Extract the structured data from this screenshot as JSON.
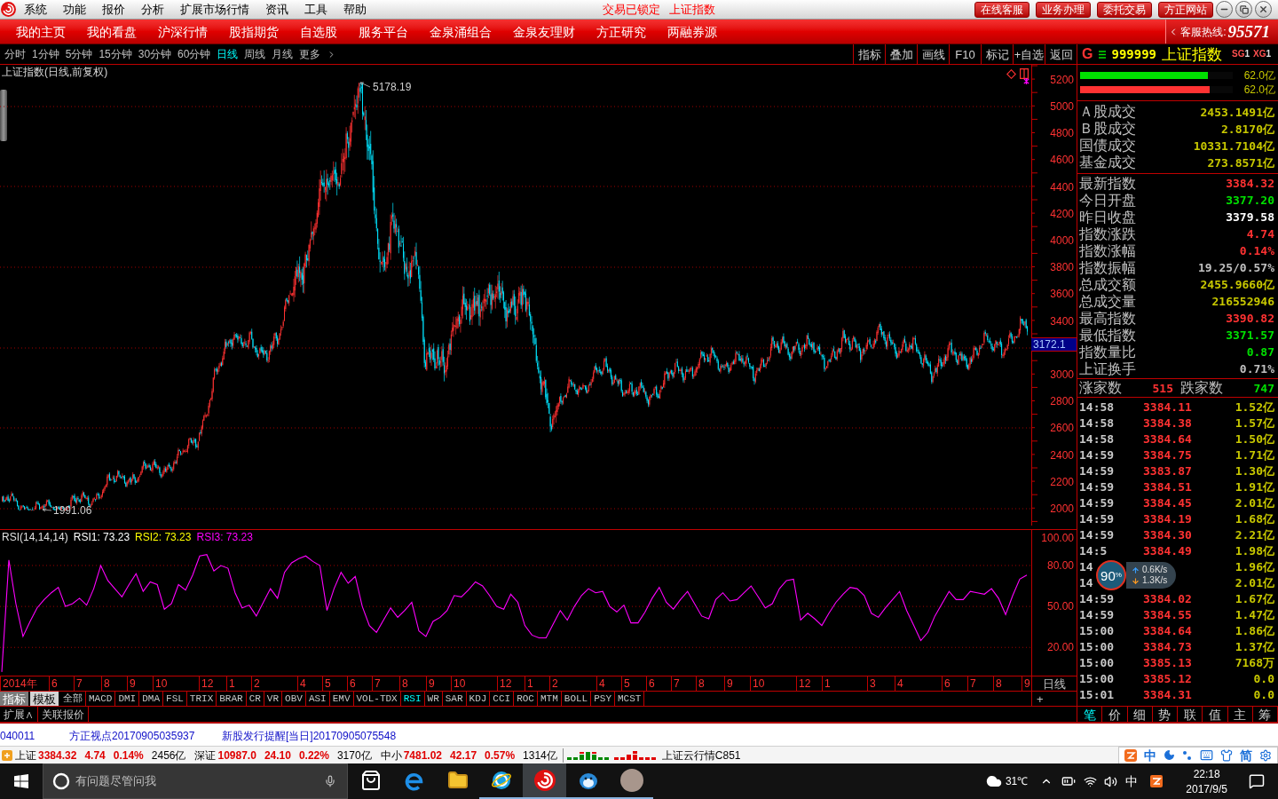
{
  "menu_bar": {
    "menus": [
      "系统",
      "功能",
      "报价",
      "分析",
      "扩展市场行情",
      "资讯",
      "工具",
      "帮助"
    ],
    "status": [
      "交易已锁定",
      "上证指数"
    ],
    "buttons": [
      "在线客服",
      "业务办理",
      "委托交易",
      "方正网站"
    ]
  },
  "nav_bar": {
    "items": [
      "我的主页",
      "我的看盘",
      "沪深行情",
      "股指期货",
      "自选股",
      "服务平台",
      "金泉涌组合",
      "金泉友理财",
      "方正研究",
      "两融券源"
    ],
    "hotline_label": "客服热线:",
    "hotline_number": "95571"
  },
  "period_bar": {
    "periods": [
      {
        "label": "分时",
        "selected": false
      },
      {
        "label": "1分钟",
        "selected": false
      },
      {
        "label": "5分钟",
        "selected": false
      },
      {
        "label": "15分钟",
        "selected": false
      },
      {
        "label": "30分钟",
        "selected": false
      },
      {
        "label": "60分钟",
        "selected": false
      },
      {
        "label": "日线",
        "selected": true
      },
      {
        "label": "周线",
        "selected": false
      },
      {
        "label": "月线",
        "selected": false
      }
    ],
    "more": "更多"
  },
  "chart_tools": [
    "指标",
    "叠加",
    "画线",
    "F10",
    "标记",
    "+自选",
    "返回"
  ],
  "quote_header": {
    "letter": "G",
    "code": "999999",
    "name": "上证指数",
    "flags": [
      {
        "label": "SG",
        "count": "1"
      },
      {
        "label": "XG",
        "count": "1"
      }
    ]
  },
  "main_chart": {
    "title": "上证指数(日线,前复权)",
    "high_label": "5178.19",
    "low_label": "1991.06",
    "price_axis": [
      "5200",
      "5000",
      "4800",
      "4600",
      "4400",
      "4200",
      "4000",
      "3800",
      "3600",
      "3400",
      "3000",
      "2800",
      "2600",
      "2400",
      "2200",
      "2000"
    ],
    "cursor_price": "3172.1"
  },
  "rsi_panel": {
    "legend": [
      {
        "text": "RSI(14,14,14)",
        "color": "#e0e0e0"
      },
      {
        "text": "RSI1: 73.23",
        "color": "#ffffff"
      },
      {
        "text": "RSI2: 73.23",
        "color": "#ffff00"
      },
      {
        "text": "RSI3: 73.23",
        "color": "#ff00ff"
      }
    ],
    "chart_data": {
      "type": "line",
      "grid": true,
      "ylim": [
        0,
        106
      ],
      "yticks": [
        {
          "value": 100,
          "label": "100.00"
        },
        {
          "value": 80,
          "label": "80.00"
        },
        {
          "value": 50,
          "label": "50.00"
        },
        {
          "value": 20,
          "label": "20.00"
        }
      ],
      "series": [
        {
          "color": "#ff00ff",
          "values": [
            2,
            84,
            52,
            28,
            39,
            49,
            55,
            60,
            64,
            50,
            52,
            56,
            51,
            63,
            80,
            69,
            63,
            57,
            66,
            74,
            61,
            68,
            66,
            48,
            52,
            66,
            62,
            73,
            87,
            88,
            76,
            80,
            78,
            60,
            49,
            51,
            43,
            53,
            63,
            56,
            75,
            82,
            85,
            87,
            83,
            80,
            47,
            63,
            75,
            67,
            72,
            50,
            36,
            31,
            40,
            49,
            42,
            47,
            53,
            32,
            28,
            39,
            42,
            47,
            58,
            57,
            62,
            68,
            65,
            58,
            50,
            48,
            59,
            53,
            36,
            29,
            27,
            27,
            37,
            47,
            40,
            50,
            58,
            63,
            60,
            61,
            50,
            46,
            51,
            38,
            38,
            46,
            56,
            64,
            53,
            48,
            55,
            61,
            52,
            43,
            41,
            55,
            60,
            54,
            55,
            60,
            65,
            57,
            49,
            52,
            63,
            69,
            70,
            40,
            45,
            41,
            36,
            45,
            53,
            59,
            64,
            63,
            58,
            45,
            42,
            49,
            55,
            61,
            47,
            36,
            25,
            31,
            43,
            52,
            61,
            55,
            55,
            61,
            60,
            59,
            63,
            56,
            44,
            58,
            70,
            73
          ]
        }
      ]
    }
  },
  "time_axis": {
    "labels": [
      "2014年",
      "6",
      "7",
      "8",
      "9",
      "10",
      "12",
      "1",
      "2",
      "4",
      "5",
      "6",
      "7",
      "8",
      "9",
      "10",
      "12",
      "1",
      "2",
      "4",
      "5",
      "6",
      "7",
      "8",
      "9",
      "10",
      "12",
      "1",
      "3",
      "4",
      "6",
      "7",
      "8",
      "9"
    ],
    "period": "日线"
  },
  "indicator_bar": {
    "modes": [
      {
        "label": "指标",
        "selected": true
      },
      {
        "label": "模板",
        "selected": false
      }
    ],
    "indicators": [
      {
        "label": "全部",
        "selected": false
      },
      {
        "label": "MACD",
        "selected": false
      },
      {
        "label": "DMI",
        "selected": false
      },
      {
        "label": "DMA",
        "selected": false
      },
      {
        "label": "FSL",
        "selected": false
      },
      {
        "label": "TRIX",
        "selected": false
      },
      {
        "label": "BRAR",
        "selected": false
      },
      {
        "label": "CR",
        "selected": false
      },
      {
        "label": "VR",
        "selected": false
      },
      {
        "label": "OBV",
        "selected": false
      },
      {
        "label": "ASI",
        "selected": false
      },
      {
        "label": "EMV",
        "selected": false
      },
      {
        "label": "VOL-TDX",
        "selected": false
      },
      {
        "label": "RSI",
        "selected": true
      },
      {
        "label": "WR",
        "selected": false
      },
      {
        "label": "SAR",
        "selected": false
      },
      {
        "label": "KDJ",
        "selected": false
      },
      {
        "label": "CCI",
        "selected": false
      },
      {
        "label": "ROC",
        "selected": false
      },
      {
        "label": "MTM",
        "selected": false
      },
      {
        "label": "BOLL",
        "selected": false
      },
      {
        "label": "PSY",
        "selected": false
      },
      {
        "label": "MCST",
        "selected": false
      }
    ],
    "add": "+"
  },
  "extension_bar": [
    "扩展∧",
    "关联报价"
  ],
  "quote_panel": {
    "volume_bars": [
      {
        "color": "#00e000",
        "level": 0.84,
        "amount": "62.0亿"
      },
      {
        "color": "#ff3232",
        "level": 0.85,
        "amount": "62.0亿"
      }
    ],
    "turnover": [
      {
        "label": "Ａ股成交",
        "value": "2453.1491亿"
      },
      {
        "label": "Ｂ股成交",
        "value": "2.8170亿"
      },
      {
        "label": "国债成交",
        "value": "10331.7104亿"
      },
      {
        "label": "基金成交",
        "value": "273.8571亿"
      }
    ],
    "stats": [
      {
        "label": "最新指数",
        "value": "3384.32",
        "color": "#ff3232"
      },
      {
        "label": "今日开盘",
        "value": "3377.20",
        "color": "#00e000"
      },
      {
        "label": "昨日收盘",
        "value": "3379.58",
        "color": "#ffffff"
      },
      {
        "label": "指数涨跌",
        "value": "4.74",
        "color": "#ff3232"
      },
      {
        "label": "指数涨幅",
        "value": "0.14%",
        "color": "#ff3232"
      },
      {
        "label": "指数振幅",
        "value": "19.25/0.57%",
        "color": "#c0c0c0"
      },
      {
        "label": "总成交额",
        "value": "2455.9660亿",
        "color": "#c8c800"
      },
      {
        "label": "总成交量",
        "value": "216552946",
        "color": "#c8c800"
      },
      {
        "label": "最高指数",
        "value": "3390.82",
        "color": "#ff3232"
      },
      {
        "label": "最低指数",
        "value": "3371.57",
        "color": "#00e000"
      },
      {
        "label": "指数量比",
        "value": "0.87",
        "color": "#00e000"
      },
      {
        "label": "上证换手",
        "value": "0.71%",
        "color": "#c0c0c0"
      }
    ],
    "breadth": {
      "up_label": "涨家数",
      "up_count": "515",
      "down_label": "跌家数",
      "down_count": "747"
    },
    "ticks": [
      {
        "time": "14:58",
        "price": "3384.11",
        "amount": "1.52亿"
      },
      {
        "time": "14:58",
        "price": "3384.38",
        "amount": "1.57亿"
      },
      {
        "time": "14:58",
        "price": "3384.64",
        "amount": "1.50亿"
      },
      {
        "time": "14:59",
        "price": "3384.75",
        "amount": "1.71亿"
      },
      {
        "time": "14:59",
        "price": "3383.87",
        "amount": "1.30亿"
      },
      {
        "time": "14:59",
        "price": "3384.51",
        "amount": "1.91亿"
      },
      {
        "time": "14:59",
        "price": "3384.45",
        "amount": "2.01亿"
      },
      {
        "time": "14:59",
        "price": "3384.19",
        "amount": "1.68亿"
      },
      {
        "time": "14:59",
        "price": "3384.30",
        "amount": "2.21亿"
      },
      {
        "time": "14:5",
        "price": "3384.49",
        "amount": "1.98亿"
      },
      {
        "time": "14",
        "amount": "1.96亿"
      },
      {
        "time": "14",
        "amount": "2.01亿"
      },
      {
        "time": "14:59",
        "price": "3384.02",
        "amount": "1.67亿"
      },
      {
        "time": "14:59",
        "price": "3384.55",
        "amount": "1.47亿"
      },
      {
        "time": "15:00",
        "price": "3384.64",
        "amount": "1.86亿"
      },
      {
        "time": "15:00",
        "price": "3384.73",
        "amount": "1.37亿"
      },
      {
        "time": "15:00",
        "price": "3385.13",
        "amount": "7168万"
      },
      {
        "time": "15:00",
        "price": "3385.12",
        "amount": "0.0"
      },
      {
        "time": "15:01",
        "price": "3384.31",
        "amount": "0.0"
      }
    ],
    "tabs": [
      {
        "label": "笔",
        "selected": true
      },
      {
        "label": "价",
        "selected": false
      },
      {
        "label": "细",
        "selected": false
      },
      {
        "label": "势",
        "selected": false
      },
      {
        "label": "联",
        "selected": false
      },
      {
        "label": "值",
        "selected": false
      },
      {
        "label": "主",
        "selected": false
      },
      {
        "label": "筹",
        "selected": false
      }
    ]
  },
  "speed_widget": {
    "percent": "90",
    "unit": "%",
    "upload": "0.6K/s",
    "download": "1.3K/s"
  },
  "news_ticker": [
    "040011",
    "方正视点20170905035937",
    "新股发行提醒[当日]20170905075548"
  ],
  "market_bar": {
    "indices": [
      {
        "name": "上证",
        "value": "3384.32",
        "change": "4.74",
        "percent": "0.14%",
        "turnover": "2456亿"
      },
      {
        "name": "深证",
        "value": "10987.0",
        "change": "24.10",
        "percent": "0.22%",
        "turnover": "3170亿"
      },
      {
        "name": "中小",
        "value": "7481.02",
        "change": "42.17",
        "percent": "0.57%",
        "turnover": "1314亿"
      }
    ],
    "cloud": "上证云行情C851"
  },
  "ime_bar": {
    "mode": "中",
    "script": "简"
  },
  "taskbar": {
    "search_placeholder": "有问题尽管问我",
    "apps": [
      {
        "kind": "store",
        "selected": false,
        "running": false
      },
      {
        "kind": "edge",
        "selected": false,
        "running": false
      },
      {
        "kind": "explorer",
        "selected": false,
        "running": false
      },
      {
        "kind": "ie",
        "selected": false,
        "running": true
      },
      {
        "kind": "trading",
        "selected": true,
        "running": true
      },
      {
        "kind": "chat",
        "selected": false,
        "running": true
      },
      {
        "kind": "photo",
        "selected": false,
        "running": true
      }
    ],
    "temperature": "31℃",
    "ime": "中",
    "time": "22:18",
    "date": "2017/9/5"
  }
}
